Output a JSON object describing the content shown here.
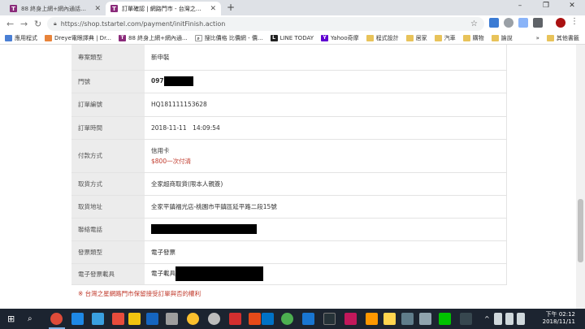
{
  "browser": {
    "tabs": [
      {
        "title": "88 終身上網+網內通話吃到飽 - ...",
        "icon": "T"
      },
      {
        "title": "訂單確認 | 網路門市 - 台灣之星T...",
        "icon": "T"
      }
    ],
    "new_tab_label": "+",
    "url": "https://shop.tstartel.com/payment/initFinish.action",
    "window_controls": [
      "–",
      "❐",
      "✕"
    ]
  },
  "bookmarks": [
    {
      "label": "應用程式",
      "icon": "apps-grid-icon"
    },
    {
      "label": "Dreye電眼譯典 | Dr...",
      "icon": "dreye-icon"
    },
    {
      "label": "88 終身上網+網內通...",
      "icon": "T"
    },
    {
      "label": "搜比價格 比價網 - 價...",
      "icon": "search-icon"
    },
    {
      "label": "LINE TODAY",
      "icon": "L"
    },
    {
      "label": "Yahoo奇摩",
      "icon": "Y"
    },
    {
      "label": "程式設計",
      "icon": "folder-icon"
    },
    {
      "label": "居家",
      "icon": "folder-icon"
    },
    {
      "label": "汽車",
      "icon": "folder-icon"
    },
    {
      "label": "購物",
      "icon": "folder-icon"
    },
    {
      "label": "論說",
      "icon": "folder-icon"
    },
    {
      "label": "»",
      "icon": ""
    },
    {
      "label": "其他書籤",
      "icon": "folder-icon"
    }
  ],
  "order": {
    "rows": [
      {
        "label": "專案類型",
        "value": "新申裝"
      },
      {
        "label": "門號",
        "value": "097"
      },
      {
        "label": "訂單編號",
        "value": "HQ181111153628"
      },
      {
        "label": "訂單時間",
        "value": "2018-11-11　14:09:54"
      },
      {
        "label": "付款方式",
        "value": "信用卡",
        "value2": "$800一次付清"
      },
      {
        "label": "取貨方式",
        "value": "全家超商取貨(限本人親簽)"
      },
      {
        "label": "取貨地址",
        "value": "全家平鎮福光店-桃園市平鎮區延平路二段15號"
      },
      {
        "label": "聯絡電話",
        "value": ""
      },
      {
        "label": "發票類型",
        "value": "電子發票"
      },
      {
        "label": "電子發票載具",
        "value": "電子載具"
      }
    ],
    "note": "※ 台灣之星網路門市保留接受訂單與否的權利"
  },
  "taskbar": {
    "time": "下午 02:12",
    "date": "2018/11/11"
  },
  "colors": {
    "accent_red": "#c0392b",
    "label_bg": "#ececec",
    "taskbar_bg": "#1c2430"
  }
}
